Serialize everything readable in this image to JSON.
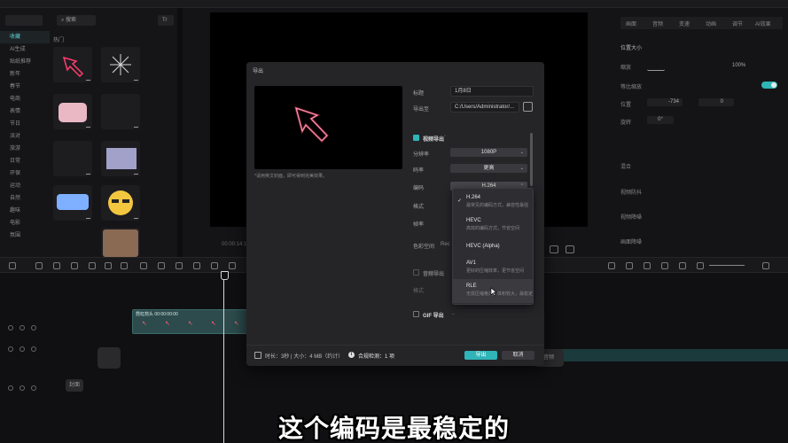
{
  "editor": {
    "left_tabs": [
      "搜索",
      "Tr"
    ],
    "left_categories": [
      "收藏",
      "AI生成",
      "贴纸推荐",
      "新年",
      "春节",
      "电商",
      "表情",
      "节日",
      "派对",
      "旅游",
      "日常",
      "环保",
      "运动",
      "自然",
      "趣味",
      "电影",
      "氛围"
    ],
    "left_sub": "热门",
    "right_tabs": [
      "画面",
      "音频",
      "变速",
      "动画",
      "调节",
      "AI效果"
    ],
    "right_rows": {
      "size_label": "位置大小",
      "scale_label": "缩放",
      "scale_value": "100%",
      "uniform_label": "等比缩放",
      "position_label": "位置",
      "pos_x": "-734",
      "pos_y": "0",
      "rotate_label": "旋转",
      "rotate_value": "0°",
      "blend_label": "混合",
      "stabilize_label": "视频防抖",
      "denoise_label": "视频降噪",
      "frame_label": "画面降噪"
    },
    "preview_time": "00:00:14:10",
    "clip_label": "霓虹箭头 00:00:00:00",
    "cover_label": "封面",
    "right_pill": "音频"
  },
  "dialog": {
    "title": "导出",
    "cover_hint": "*请用英文封面，即可得到完美效果。",
    "title_label": "标题",
    "title_value": "1月8日",
    "export_to_label": "导出至",
    "export_path": "C:/Users/Administrator/...",
    "video_section": "视频导出",
    "resolution_label": "分辨率",
    "resolution_value": "1080P",
    "bitrate_label": "码率",
    "bitrate_value": "更高",
    "codec_label": "编码",
    "codec_value": "H.264",
    "format_label": "格式",
    "framerate_label": "帧率",
    "color_label": "色彩空间",
    "color_value": "Rec",
    "audio_section": "音频导出",
    "audio_format_label": "格式",
    "gif_section": "GIF 导出",
    "footer_info": "时长：3秒 | 大小：4 MB（约计）",
    "footer_check": "合规检测：1 项",
    "export_button": "导出",
    "cancel_button": "取消"
  },
  "codec_dropdown": [
    {
      "name": "H.264",
      "desc": "最常见的编码方式，兼容性最强",
      "selected": true
    },
    {
      "name": "HEVC",
      "desc": "高效的编码方式，节省空间",
      "selected": false
    },
    {
      "name": "HEVC (Alpha)",
      "desc": "",
      "selected": false
    },
    {
      "name": "AV1",
      "desc": "更好的压缩效率，更节省空间",
      "selected": false
    },
    {
      "name": "RLE",
      "desc": "无损压缩格式，体积较大，最稳定",
      "selected": false,
      "hover": true
    }
  ],
  "subtitle": "这个编码是最稳定的",
  "colors": {
    "accent": "#2fb4b7",
    "neon": "#ff3d6e"
  }
}
